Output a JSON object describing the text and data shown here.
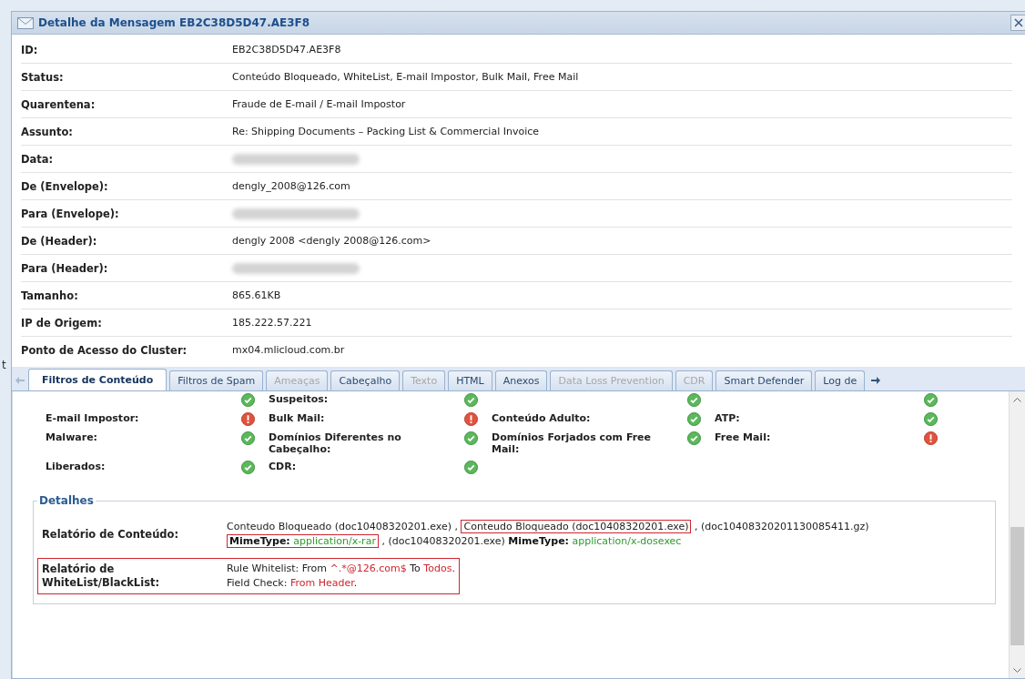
{
  "background_text": "t",
  "window": {
    "title": "Detalhe da Mensagem EB2C38D5D47.AE3F8"
  },
  "properties": [
    {
      "label": "ID:",
      "value": "EB2C38D5D47.AE3F8",
      "redacted": false
    },
    {
      "label": "Status:",
      "value": "Conteúdo Bloqueado, WhiteList, E-mail Impostor, Bulk Mail, Free Mail",
      "redacted": false
    },
    {
      "label": "Quarentena:",
      "value": "Fraude de E-mail / E-mail Impostor",
      "redacted": false
    },
    {
      "label": "Assunto:",
      "value": "Re: Shipping Documents – Packing List & Commercial Invoice",
      "redacted": false
    },
    {
      "label": "Data:",
      "redacted": true
    },
    {
      "label": "De (Envelope):",
      "value": "dengly_2008@126.com",
      "redacted": false
    },
    {
      "label": "Para (Envelope):",
      "redacted": true
    },
    {
      "label": "De (Header):",
      "value": "dengly 2008 <dengly 2008@126.com>",
      "redacted": false
    },
    {
      "label": "Para (Header):",
      "redacted": true
    },
    {
      "label": "Tamanho:",
      "value": "865.61KB",
      "redacted": false
    },
    {
      "label": "IP de Origem:",
      "value": "185.222.57.221",
      "redacted": false
    },
    {
      "label": "Ponto de Acesso do Cluster:",
      "value": "mx04.mlicloud.com.br",
      "redacted": false
    }
  ],
  "tabs": [
    {
      "label": "Filtros de Conteúdo",
      "selected": true,
      "disabled": false
    },
    {
      "label": "Filtros de Spam",
      "selected": false,
      "disabled": false
    },
    {
      "label": "Ameaças",
      "selected": false,
      "disabled": true
    },
    {
      "label": "Cabeçalho",
      "selected": false,
      "disabled": false
    },
    {
      "label": "Texto",
      "selected": false,
      "disabled": true
    },
    {
      "label": "HTML",
      "selected": false,
      "disabled": false
    },
    {
      "label": "Anexos",
      "selected": false,
      "disabled": false
    },
    {
      "label": "Data Loss Prevention",
      "selected": false,
      "disabled": true
    },
    {
      "label": "CDR",
      "selected": false,
      "disabled": true
    },
    {
      "label": "Smart Defender",
      "selected": false,
      "disabled": false
    },
    {
      "label": "Log de",
      "selected": false,
      "disabled": false
    }
  ],
  "filters": [
    [
      {
        "alert": false
      },
      {
        "label": "Suspeitos:",
        "alert": false
      },
      {
        "alert": false
      },
      {
        "alert": false
      }
    ],
    [
      {
        "label": "E-mail Impostor:",
        "alert": true
      },
      {
        "label": "Bulk Mail:",
        "alert": true
      },
      {
        "label": "Conteúdo Adulto:",
        "alert": false
      },
      {
        "label": "ATP:",
        "alert": false
      }
    ],
    [
      {
        "label": "Malware:",
        "alert": false
      },
      {
        "label": "Domínios Diferentes no Cabeçalho:",
        "alert": false
      },
      {
        "label": "Domínios Forjados com Free Mail:",
        "alert": false
      },
      {
        "label": "Free Mail:",
        "alert": true
      }
    ],
    [
      {
        "label": "Liberados:",
        "alert": false
      },
      {
        "label": "CDR:",
        "alert": false
      }
    ]
  ],
  "details": {
    "legend": "Detalhes",
    "rows": [
      {
        "label": "Relatório de Conteúdo:",
        "highlighted": false,
        "lines": [
          [
            {
              "kind": "plain",
              "text": "Conteudo Bloqueado (doc10408320201.exe) ,"
            },
            {
              "kind": "boxed",
              "parts": [
                {
                  "kind": "plain",
                  "text": "Conteudo Bloqueado (doc10408320201.exe)"
                }
              ]
            },
            {
              "kind": "plain",
              "text": ", (doc10408320201130085411.gz)"
            }
          ],
          [
            {
              "kind": "boxed",
              "parts": [
                {
                  "kind": "bold",
                  "text": "MimeType:"
                },
                {
                  "kind": "green",
                  "text": "application/x-rar"
                }
              ]
            },
            {
              "kind": "plain",
              "text": ", (doc10408320201.exe)"
            },
            {
              "kind": "bold",
              "text": "MimeType:"
            },
            {
              "kind": "green",
              "text": "application/x-dosexec"
            }
          ]
        ]
      },
      {
        "label": "Relatório de WhiteList/BlackList:",
        "highlighted": true,
        "lines": [
          [
            {
              "kind": "plain",
              "text": "Rule Whitelist: From"
            },
            {
              "kind": "red",
              "text": "^.*@126.com$"
            },
            {
              "kind": "plain",
              "text": "To"
            },
            {
              "kind": "red",
              "text": "Todos"
            },
            {
              "kind": "plain",
              "text": "."
            }
          ],
          [
            {
              "kind": "plain",
              "text": "Field Check:"
            },
            {
              "kind": "red",
              "text": "From Header"
            },
            {
              "kind": "plain",
              "text": "."
            }
          ]
        ]
      }
    ]
  }
}
